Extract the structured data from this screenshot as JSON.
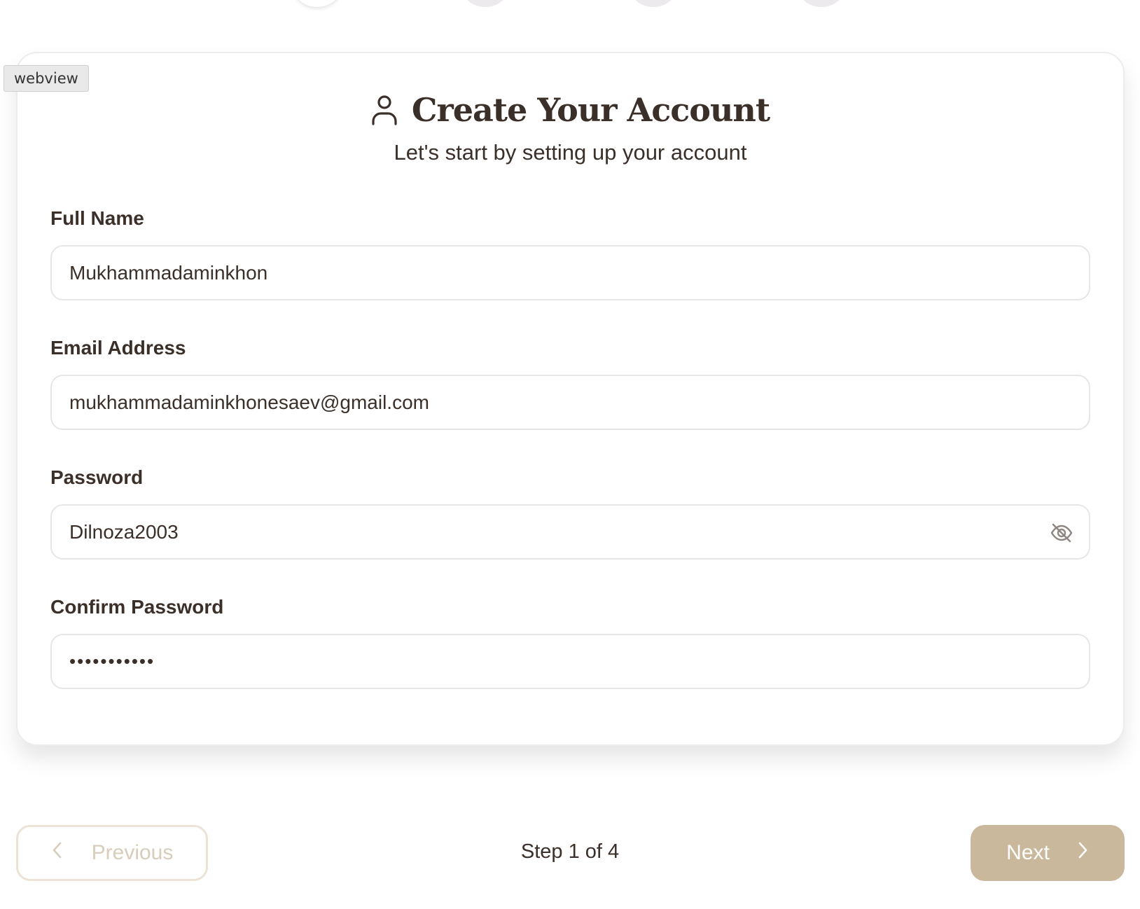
{
  "stepper": {
    "current_step": 1,
    "total_steps": 4
  },
  "webview_tag": "webview",
  "header": {
    "icon": "user-icon",
    "title": "Create Your Account",
    "subtitle": "Let's start by setting up your account"
  },
  "form": {
    "full_name": {
      "label": "Full Name",
      "value": "Mukhammadaminkhon"
    },
    "email": {
      "label": "Email Address",
      "value": "mukhammadaminkhonesaev@gmail.com"
    },
    "password": {
      "label": "Password",
      "value": "Dilnoza2003",
      "toggle_icon": "eye-off-icon"
    },
    "confirm_password": {
      "label": "Confirm Password",
      "masked_value": "•••••••••••"
    }
  },
  "footer": {
    "previous_label": "Previous",
    "step_text": "Step 1 of 4",
    "next_label": "Next"
  },
  "colors": {
    "text": "#3b2f2a",
    "accent": "#c9b89b",
    "prev_disabled": "#d8ccbc",
    "border": "#e8e6e4"
  }
}
